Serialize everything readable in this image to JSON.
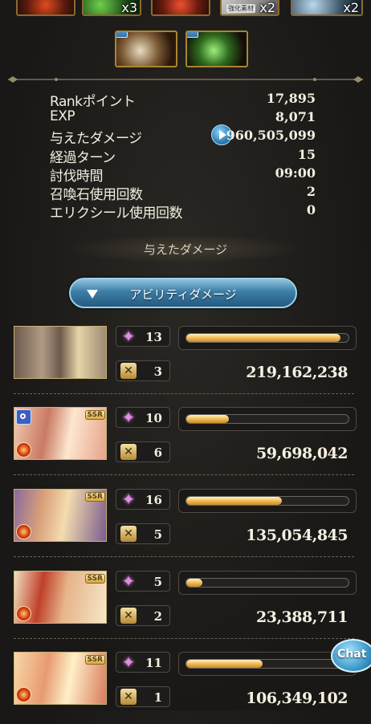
{
  "rewards_top": [
    {
      "qty": ""
    },
    {
      "qty": "x3"
    },
    {
      "qty": ""
    },
    {
      "qty": "x2",
      "tag": "強化素材"
    },
    {
      "qty": "x2"
    }
  ],
  "stats": [
    {
      "label": "Rankポイント",
      "value": "17,895"
    },
    {
      "label": "EXP",
      "value": "8,071"
    },
    {
      "label": "与えたダメージ",
      "value": "960,505,099"
    },
    {
      "label": "経過ターン",
      "value": "15"
    },
    {
      "label": "討伐時間",
      "value": "09:00"
    },
    {
      "label": "召喚石使用回数",
      "value": "2"
    },
    {
      "label": "エリクシール使用回数",
      "value": "0"
    }
  ],
  "section_title": "与えたダメージ",
  "dropdown_label": "アビリティダメージ",
  "characters": [
    {
      "ca_count": "13",
      "skill_count": "3",
      "damage": "219,162,238",
      "share": 0.95,
      "ssr": ""
    },
    {
      "ca_count": "10",
      "skill_count": "6",
      "damage": "59,698,042",
      "share": 0.26,
      "ssr": "SSR"
    },
    {
      "ca_count": "16",
      "skill_count": "5",
      "damage": "135,054,845",
      "share": 0.59,
      "ssr": "SSR"
    },
    {
      "ca_count": "5",
      "skill_count": "2",
      "damage": "23,388,711",
      "share": 0.1,
      "ssr": "SSR"
    },
    {
      "ca_count": "11",
      "skill_count": "1",
      "damage": "106,349,102",
      "share": 0.47,
      "ssr": "SSR"
    }
  ],
  "chat_label": "Chat"
}
